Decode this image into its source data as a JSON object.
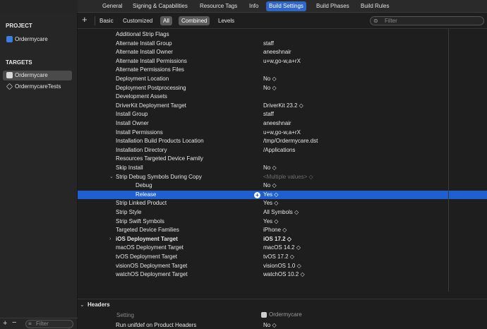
{
  "tabs": [
    "General",
    "Signing & Capabilities",
    "Resource Tags",
    "Info",
    "Build Settings",
    "Build Phases",
    "Build Rules"
  ],
  "active_tab": "Build Settings",
  "sidebar": {
    "project_header": "PROJECT",
    "project": "Ordermycare",
    "targets_header": "TARGETS",
    "targets": [
      "Ordermycare",
      "OrdermycareTests"
    ],
    "filter_placeholder": "Filter",
    "add_symbol": "+",
    "remove_symbol": "−",
    "filter_icon": "≡"
  },
  "filterbar": {
    "add_symbol": "+",
    "buttons": [
      "Basic",
      "Customized",
      "All",
      "Combined",
      "Levels"
    ],
    "selected": [
      "All",
      "Combined"
    ],
    "search_placeholder": "Filter",
    "search_icon": "⊜"
  },
  "settings": [
    {
      "name": "Additional Strip Flags",
      "value": ""
    },
    {
      "name": "Alternate Install Group",
      "value": "staff"
    },
    {
      "name": "Alternate Install Owner",
      "value": "aneeshnair"
    },
    {
      "name": "Alternate Install Permissions",
      "value": "u+w,go-w,a+rX"
    },
    {
      "name": "Alternate Permissions Files",
      "value": ""
    },
    {
      "name": "Deployment Location",
      "value": "No ◇"
    },
    {
      "name": "Deployment Postprocessing",
      "value": "No ◇"
    },
    {
      "name": "Development Assets",
      "value": ""
    },
    {
      "name": "DriverKit Deployment Target",
      "value": "DriverKit 23.2 ◇"
    },
    {
      "name": "Install Group",
      "value": "staff"
    },
    {
      "name": "Install Owner",
      "value": "aneeshnair"
    },
    {
      "name": "Install Permissions",
      "value": "u+w,go-w,a+rX"
    },
    {
      "name": "Installation Build Products Location",
      "value": "/tmp/Ordermycare.dst"
    },
    {
      "name": "Installation Directory",
      "value": "/Applications"
    },
    {
      "name": "Resources Targeted Device Family",
      "value": ""
    },
    {
      "name": "Skip Install",
      "value": "No ◇"
    },
    {
      "name": "Strip Debug Symbols During Copy",
      "value": "<Multiple values> ◇",
      "disclosure": "⌄",
      "dim": true
    },
    {
      "name": "Debug",
      "value": "No ◇",
      "indent": true
    },
    {
      "name": "Release",
      "value": "Yes ◇",
      "indent": true,
      "selected": true,
      "badge": "+"
    },
    {
      "name": "Strip Linked Product",
      "value": "Yes ◇"
    },
    {
      "name": "Strip Style",
      "value": "All Symbols ◇"
    },
    {
      "name": "Strip Swift Symbols",
      "value": "Yes ◇"
    },
    {
      "name": "Targeted Device Families",
      "value": "iPhone ◇"
    },
    {
      "name": "iOS Deployment Target",
      "value": "iOS 17.2 ◇",
      "bold": true,
      "disclosure": "›"
    },
    {
      "name": "macOS Deployment Target",
      "value": "macOS 14.2 ◇"
    },
    {
      "name": "tvOS Deployment Target",
      "value": "tvOS 17.2 ◇"
    },
    {
      "name": "visionOS Deployment Target",
      "value": "visionOS 1.0 ◇"
    },
    {
      "name": "watchOS Deployment Target",
      "value": "watchOS 10.2 ◇"
    }
  ],
  "headers_section": {
    "disclosure": "⌄",
    "title": "Headers",
    "setting_col": "Setting",
    "target_col": "Ordermycare",
    "row_name": "Run unifdef on Product Headers",
    "row_value": "No ◇"
  },
  "colors": {
    "accent": "#2f66c8",
    "selection": "#1f5fcf",
    "background": "#1e1e1e"
  }
}
